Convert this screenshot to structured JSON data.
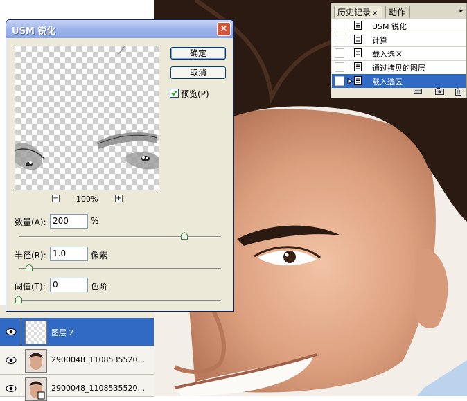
{
  "dialog": {
    "title": "USM 锐化",
    "ok_label": "确定",
    "cancel_label": "取消",
    "preview_label": "预览(P)",
    "preview_checked": true,
    "zoom_minus": "−",
    "zoom_level": "100%",
    "zoom_plus": "+",
    "amount": {
      "label": "数量(A):",
      "value": "200",
      "unit": "%",
      "slider_fraction": 0.82
    },
    "radius": {
      "label": "半径(R):",
      "value": "1.0",
      "unit": "像素",
      "slider_fraction": 0.05
    },
    "threshold": {
      "label": "阈值(T):",
      "value": "0",
      "unit": "色阶",
      "slider_fraction": 0.0
    }
  },
  "history": {
    "tabs": [
      "历史记录",
      "动作"
    ],
    "close_glyph": "×",
    "menu_glyph": "▸",
    "items": [
      "USM 锐化",
      "计算",
      "载入选区",
      "通过拷贝的图层",
      "载入选区"
    ],
    "selected_index": 4,
    "footer_icons": [
      "new-document-icon",
      "camera-icon",
      "trash-icon"
    ]
  },
  "layers": {
    "rows": [
      {
        "name": "图层 2",
        "selected": true
      },
      {
        "name": "2900048_1108535520...",
        "selected": false
      },
      {
        "name": "2900048_1108535520...",
        "selected": false
      }
    ]
  },
  "colors": {
    "selection": "#316ac5",
    "title_gradient": "#8aa6e4",
    "panel_bg": "#ece9d8"
  }
}
